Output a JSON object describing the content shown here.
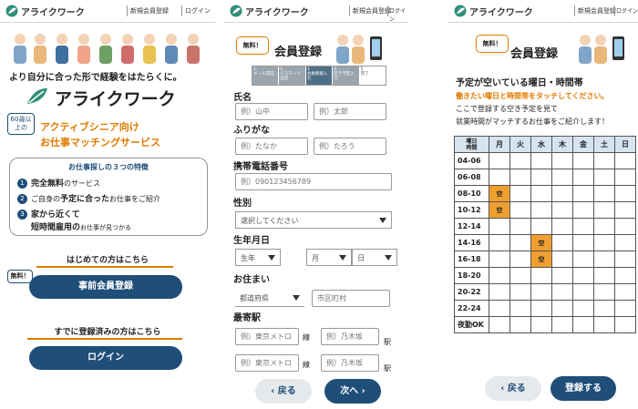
{
  "brand": {
    "name": "アライクワーク",
    "accent": "#1f4e79",
    "orange": "#e07a00",
    "logo_icon": "leaf-logo-icon"
  },
  "header": {
    "signup": "新規会員登録",
    "login": "ログイン"
  },
  "landing": {
    "tagline": "より自分に合った形で経験をはたらくに。",
    "logo_text": "アライクワーク",
    "age_badge": "60歳以上の",
    "sub1": "アクティブシニア向け",
    "sub2": "お仕事マッチングサービス",
    "features_title": "お仕事探しの３つの特徴",
    "features": [
      {
        "num": "1",
        "bold": "完全無料",
        "rest": "のサービス"
      },
      {
        "num": "2",
        "pre": "ご自身の",
        "bold": "予定に合った",
        "rest": "お仕事をご紹介"
      },
      {
        "num": "3",
        "line1": "家から近くて",
        "bold": "短時間雇用の",
        "rest": "お仕事が見つかる"
      }
    ],
    "first_time": "はじめての方はこちら",
    "free_badge": "無料！",
    "pre_register": "事前会員登録",
    "registered": "すでに登録済みの方はこちら",
    "login_btn": "ログイン"
  },
  "form": {
    "free_badge": "無料！",
    "title": "会員登録",
    "steps": [
      {
        "no": "1",
        "label": "メール認証"
      },
      {
        "no": "2",
        "label": "パスワード設定"
      },
      {
        "no": "3",
        "label": "会員情報入力"
      },
      {
        "no": "4",
        "label": "空き予定入力"
      },
      {
        "no": "5",
        "label": "完了"
      }
    ],
    "name_label": "氏名",
    "last_name_ph": "例）山中",
    "first_name_ph": "例）太郎",
    "kana_label": "ふりがな",
    "last_kana_ph": "例）たなか",
    "first_kana_ph": "例）たろう",
    "phone_label": "携帯電話番号",
    "phone_ph": "例）090123456789",
    "gender_label": "性別",
    "gender_select": "選択してください",
    "birth_label": "生年月日",
    "year": "生年",
    "month": "月",
    "day": "日",
    "address_label": "お住まい",
    "prefecture": "都道府県",
    "city_ph": "市区町村",
    "station_label": "最寄駅",
    "line_ph": "例）東京メトロ",
    "line_unit": "線",
    "station_ph": "例）乃木坂",
    "station_unit": "駅",
    "back": "戻る",
    "next": "次へ"
  },
  "schedule": {
    "free_badge": "無料！",
    "title": "会員登録",
    "heading": "予定が空いている曜日・時間帯",
    "instruction": "働きたい曜日と時間帯をタッチしてください。",
    "desc1": "ここで登録する空き予定を見て",
    "desc2": "就業時間がマッチするお仕事をご紹介します！",
    "corner_top": "曜日",
    "corner_bottom": "時間",
    "days": [
      "月",
      "火",
      "水",
      "木",
      "金",
      "土",
      "日"
    ],
    "slots": [
      "04-06",
      "06-08",
      "08-10",
      "10-12",
      "12-14",
      "14-16",
      "16-18",
      "18-20",
      "20-22",
      "22-24",
      "夜勤OK"
    ],
    "empty_mark": "空",
    "selected": [
      {
        "slot": 2,
        "day": 0
      },
      {
        "slot": 3,
        "day": 0
      },
      {
        "slot": 5,
        "day": 2
      },
      {
        "slot": 6,
        "day": 2
      }
    ],
    "back": "戻る",
    "submit": "登録する"
  }
}
